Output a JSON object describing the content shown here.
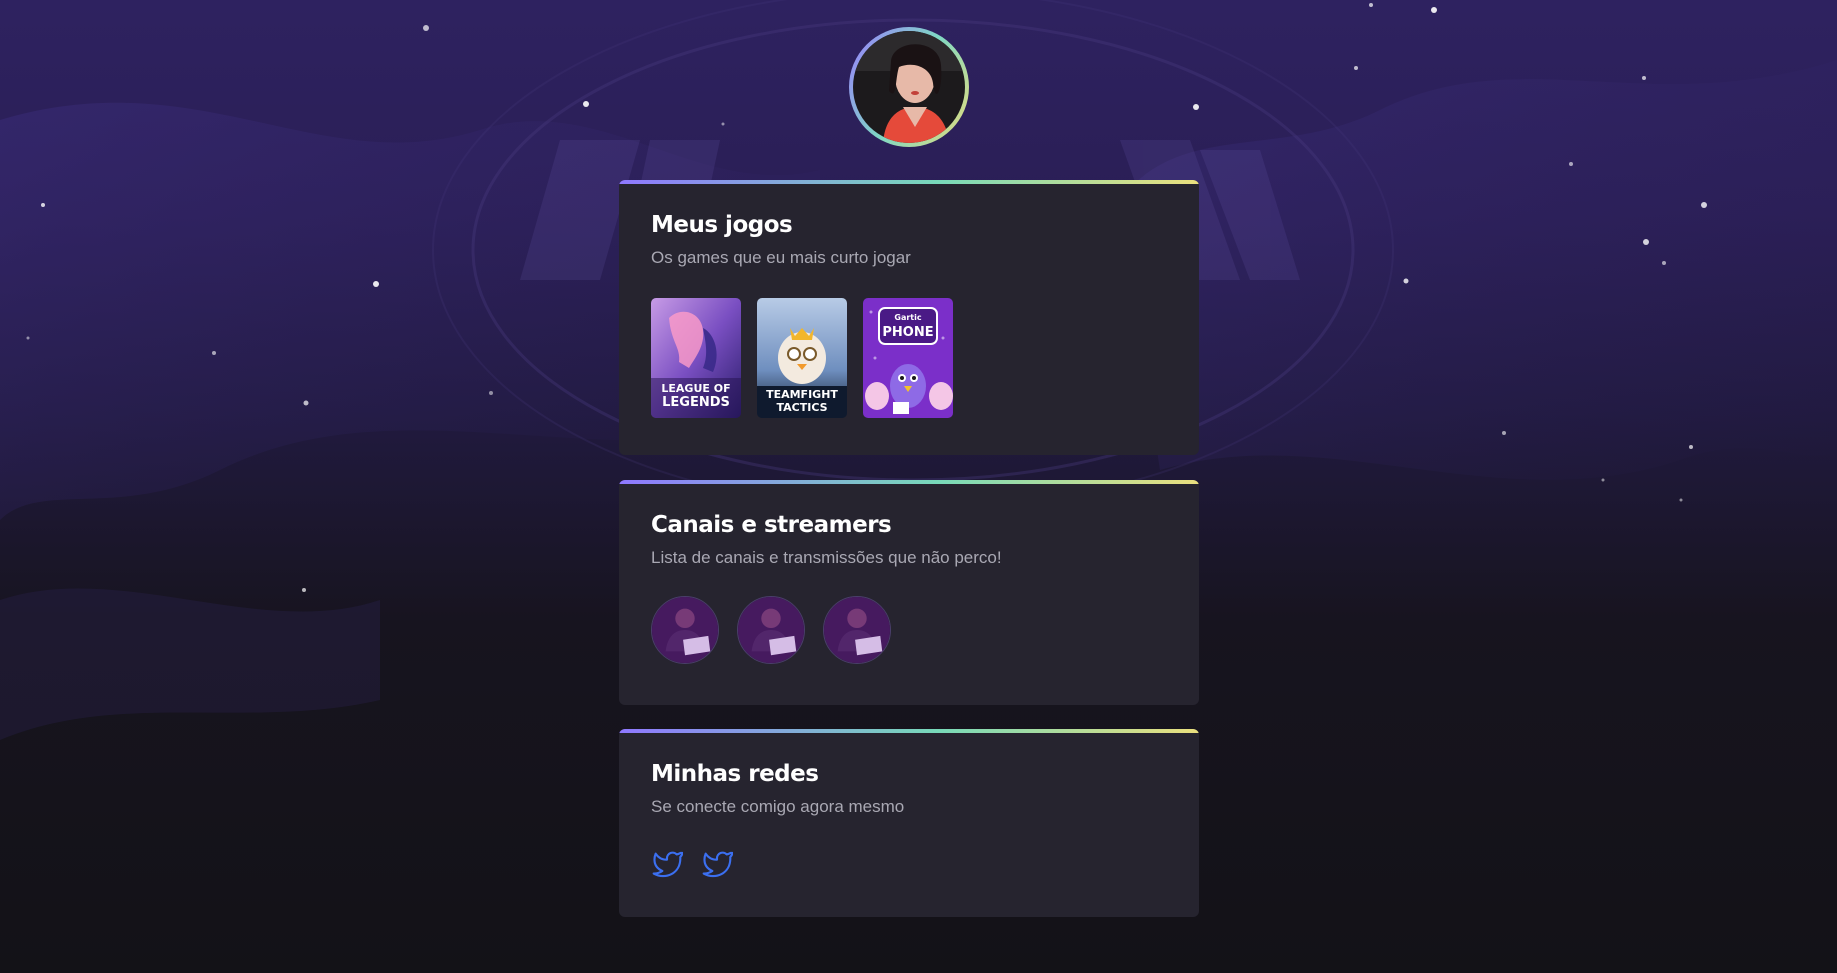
{
  "profile": {
    "avatar_alt": "avatar"
  },
  "games_section": {
    "title": "Meus jogos",
    "subtitle": "Os games que eu mais curto jogar",
    "games": [
      {
        "name_line1": "LEAGUE OF",
        "name_line2": "LEGENDS"
      },
      {
        "name_line1": "TEAMFIGHT",
        "name_line2": "TACTICS"
      },
      {
        "name_line1": "Gartic",
        "name_line2": "PHONE"
      }
    ]
  },
  "channels_section": {
    "title": "Canais e streamers",
    "subtitle": "Lista de canais e transmissões que não perco!"
  },
  "socials_section": {
    "title": "Minhas redes",
    "subtitle": "Se conecte comigo agora mesmo",
    "icons": [
      "twitter-icon",
      "twitter-icon"
    ]
  },
  "colors": {
    "accent_gradient": [
      "#8f78ff",
      "#78d9b9",
      "#ebe07e"
    ],
    "card_bg": "#26242f",
    "twitter_blue": "#3b6ff0"
  }
}
